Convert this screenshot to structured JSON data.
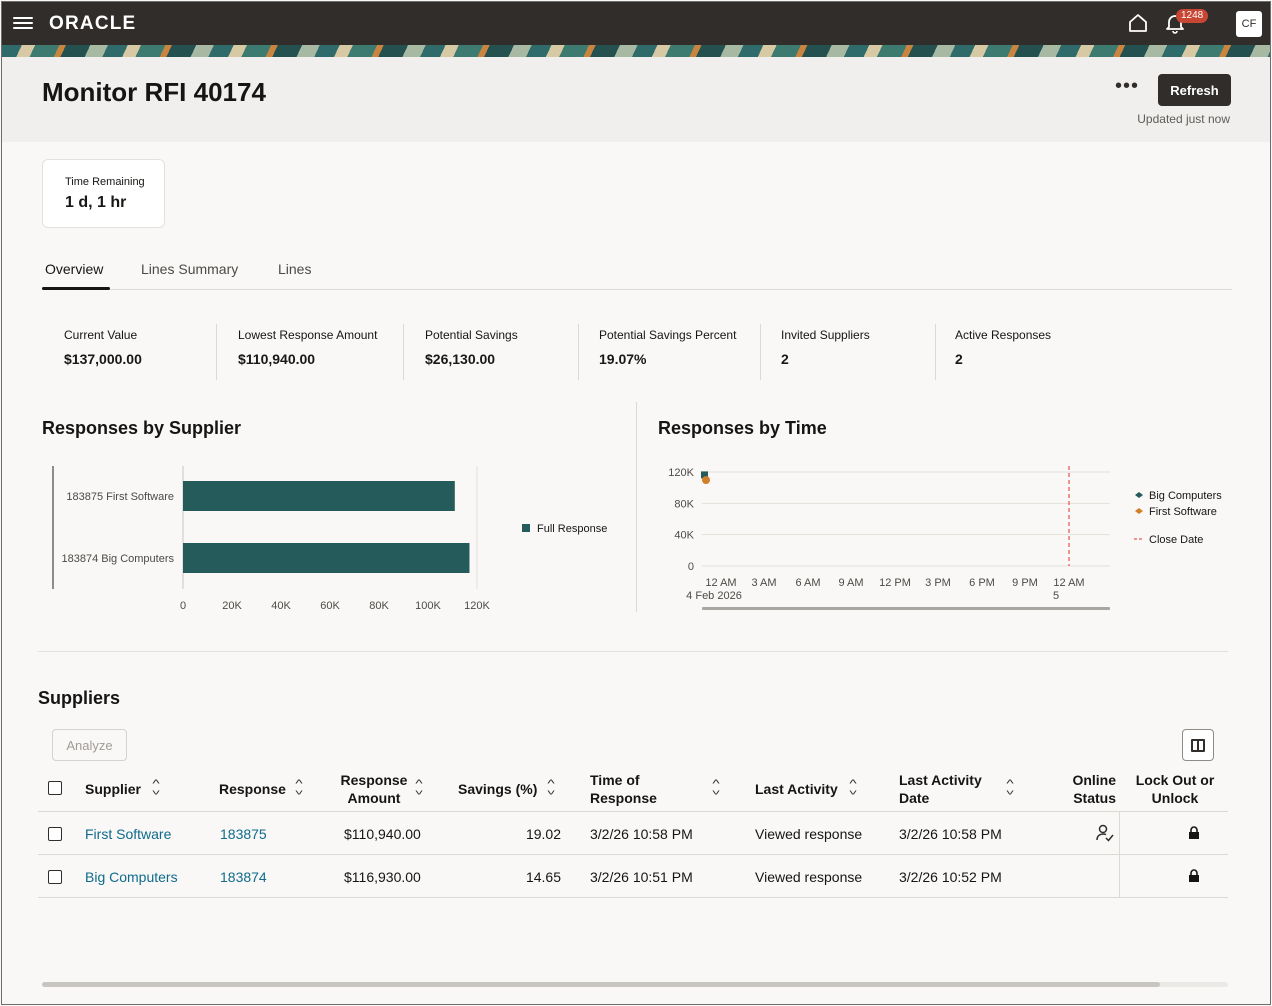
{
  "header": {
    "logo": "ORACLE",
    "notifications_count": "1248",
    "avatar_initials": "CF"
  },
  "page": {
    "title": "Monitor RFI 40174",
    "more_label": "•••",
    "refresh_label": "Refresh",
    "updated_text": "Updated just now"
  },
  "time_remaining": {
    "label": "Time Remaining",
    "value": "1 d, 1 hr"
  },
  "tabs": [
    {
      "label": "Overview",
      "active": true
    },
    {
      "label": "Lines Summary",
      "active": false
    },
    {
      "label": "Lines",
      "active": false
    }
  ],
  "metrics": [
    {
      "label": "Current Value",
      "value": "$137,000.00"
    },
    {
      "label": "Lowest Response Amount",
      "value": "$110,940.00"
    },
    {
      "label": "Potential Savings",
      "value": "$26,130.00"
    },
    {
      "label": "Potential Savings Percent",
      "value": "19.07%"
    },
    {
      "label": "Invited Suppliers",
      "value": "2"
    },
    {
      "label": "Active Responses",
      "value": "2"
    }
  ],
  "chart_data": [
    {
      "type": "bar",
      "orientation": "horizontal",
      "title": "Responses by Supplier",
      "categories": [
        "183875 First Software",
        "183874 Big Computers"
      ],
      "series": [
        {
          "name": "Full Response",
          "values": [
            110940,
            116930
          ],
          "color": "#255b5b"
        }
      ],
      "xlim": [
        0,
        120000
      ],
      "ticks": [
        "0",
        "20K",
        "40K",
        "60K",
        "80K",
        "100K",
        "120K"
      ],
      "legend_position": "right"
    },
    {
      "type": "scatter",
      "title": "Responses by Time",
      "y_ticks": [
        "0",
        "40K",
        "80K",
        "120K"
      ],
      "ylim": [
        0,
        120000
      ],
      "x_ticks": [
        "12 AM",
        "3 AM",
        "6 AM",
        "9 AM",
        "12 PM",
        "3 PM",
        "6 PM",
        "9 PM",
        "12 AM"
      ],
      "x_subticks": [
        "4 Feb 2026",
        "5"
      ],
      "series": [
        {
          "name": "Big Computers",
          "color": "#255b5b",
          "points": [
            {
              "x": "4 Feb 2026 12 AM",
              "y": 116930
            }
          ]
        },
        {
          "name": "First Software",
          "color": "#d27f2a",
          "points": [
            {
              "x": "4 Feb 2026 12 AM",
              "y": 110940
            }
          ]
        }
      ],
      "close_date": {
        "label": "Close Date",
        "color": "#e0312b",
        "x": "5 Feb 2026 12 AM"
      },
      "legend_position": "right"
    }
  ],
  "suppliers": {
    "title": "Suppliers",
    "analyze_label": "Analyze",
    "columns": [
      "Supplier",
      "Response",
      "Response Amount",
      "Savings (%)",
      "Time of Response",
      "Last Activity",
      "Last Activity Date",
      "Online Status",
      "Lock Out or Unlock"
    ],
    "rows": [
      {
        "supplier": "First Software",
        "response": "183875",
        "amount": "$110,940.00",
        "savings": "19.02",
        "time": "3/2/26 10:58 PM",
        "activity": "Viewed response",
        "activity_date": "3/2/26 10:58 PM",
        "online": true
      },
      {
        "supplier": "Big Computers",
        "response": "183874",
        "amount": "$116,930.00",
        "savings": "14.65",
        "time": "3/2/26 10:51 PM",
        "activity": "Viewed response",
        "activity_date": "3/2/26 10:52 PM",
        "online": false
      }
    ]
  }
}
